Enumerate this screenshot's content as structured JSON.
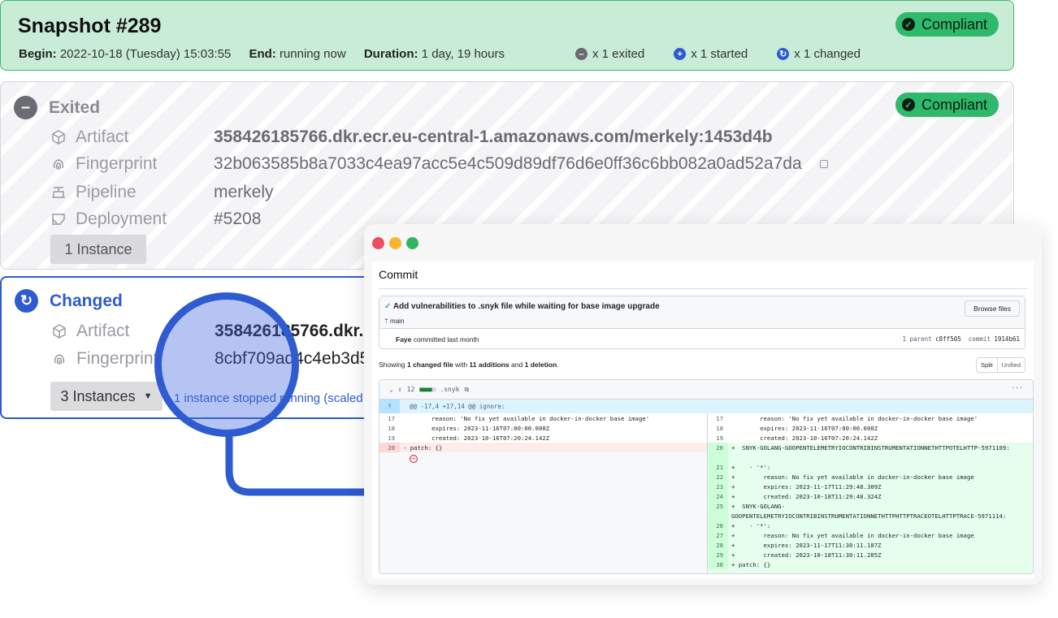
{
  "snapshot": {
    "title": "Snapshot #289",
    "begin_label": "Begin:",
    "begin_value": "2022-10-18 (Tuesday) 15:03:55",
    "end_label": "End:",
    "end_value": "running now",
    "duration_label": "Duration:",
    "duration_value": "1 day, 19 hours",
    "badge": "Compliant",
    "counts": {
      "exited": "x 1 exited",
      "started": "x 1 started",
      "changed": "x 1 changed"
    }
  },
  "exited": {
    "heading": "Exited",
    "badge": "Compliant",
    "artifact_label": "Artifact",
    "artifact_value": "358426185766.dkr.ecr.eu-central-1.amazonaws.com/merkely:1453d4b",
    "fingerprint_label": "Fingerprint",
    "fingerprint_value": "32b063585b8a7033c4ea97acc5e4c509d89df76d6e0ff36c6bb082a0ad52a7da",
    "pipeline_label": "Pipeline",
    "pipeline_value": "merkely",
    "deployment_label": "Deployment",
    "deployment_value": "#5208",
    "instances": "1 Instance"
  },
  "changed": {
    "heading": "Changed",
    "artifact_label": "Artifact",
    "artifact_value": "358426185766.dkr.ec",
    "fingerprint_label": "Fingerprint",
    "fingerprint_value": "8cbf709ad4c4eb3d5e",
    "instances": "3 Instances",
    "instances_note": "1 instance stopped running (scaled"
  },
  "commit": {
    "header": "Commit",
    "message": "Add vulnerabilities to .snyk file while waiting for base image upgrade",
    "branch": "main",
    "browse_label": "Browse files",
    "author": "Faye",
    "author_suffix": "committed last month",
    "parent_label": "1 parent",
    "parent_sha": "c8ff505",
    "commit_label": "commit",
    "commit_sha": "1914b61",
    "showing_prefix": "Showing",
    "showing_changed": "1 changed file",
    "showing_with": "with",
    "showing_additions": "11 additions",
    "showing_and": "and",
    "showing_deletions": "1 deletion",
    "split_label": "Split",
    "unified_label": "Unified",
    "file_count": "12",
    "file_name": ".snyk",
    "more": "···",
    "hunk": "@@ -17,4 +17,14 @@ ignore:",
    "left_lines": [
      {
        "n": "17",
        "t": "        reason: 'No fix yet available in docker-in-docker base image'",
        "k": "ctx"
      },
      {
        "n": "18",
        "t": "        expires: 2023-11-16T07:00:00.000Z",
        "k": "ctx"
      },
      {
        "n": "19",
        "t": "        created: 2023-10-16T07:20:24.142Z",
        "k": "ctx"
      },
      {
        "n": "20",
        "t": "- patch: {}",
        "k": "del"
      }
    ],
    "right_lines": [
      {
        "n": "17",
        "t": "        reason: 'No fix yet available in docker-in-docker base image'",
        "k": "ctx"
      },
      {
        "n": "18",
        "t": "        expires: 2023-11-16T07:00:00.000Z",
        "k": "ctx"
      },
      {
        "n": "19",
        "t": "        created: 2023-10-16T07:20:24.142Z",
        "k": "ctx"
      },
      {
        "n": "20",
        "t": "+  SNYK-GOLANG-GOOPENTELEMETRYIOCONTRIBINSTRUMENTATIONNETHTTPOTELHTTP-5971109:",
        "k": "add"
      },
      {
        "n": "",
        "t": "",
        "k": "add"
      },
      {
        "n": "21",
        "t": "+    - '*':",
        "k": "add"
      },
      {
        "n": "22",
        "t": "+        reason: No fix yet available in docker-in-docker base image",
        "k": "add"
      },
      {
        "n": "23",
        "t": "+        expires: 2023-11-17T11:29:48.309Z",
        "k": "add"
      },
      {
        "n": "24",
        "t": "+        created: 2023-10-18T11:29:48.324Z",
        "k": "add"
      },
      {
        "n": "25",
        "t": "+  SNYK-GOLANG-",
        "k": "add"
      },
      {
        "n": "",
        "t": "GOOPENTELEMETRYIOCONTRIBINSTRUMENTATIONNETHTTPHTTPTRACEOTELHTTPTRACE-5971114:",
        "k": "add"
      },
      {
        "n": "26",
        "t": "+    - '*':",
        "k": "add"
      },
      {
        "n": "27",
        "t": "+        reason: No fix yet available in docker-in-docker base image",
        "k": "add"
      },
      {
        "n": "28",
        "t": "+        expires: 2023-11-17T11:30:11.187Z",
        "k": "add"
      },
      {
        "n": "29",
        "t": "+        created: 2023-10-18T11:30:11.205Z",
        "k": "add"
      },
      {
        "n": "30",
        "t": "+ patch: {}",
        "k": "add"
      }
    ]
  },
  "colors": {
    "compliant": "#2fb96a",
    "accent": "#2f5bd0",
    "exited_icon": "#6b6b73",
    "started_icon": "#2f5bd0",
    "changed_icon": "#2f5bd0"
  }
}
